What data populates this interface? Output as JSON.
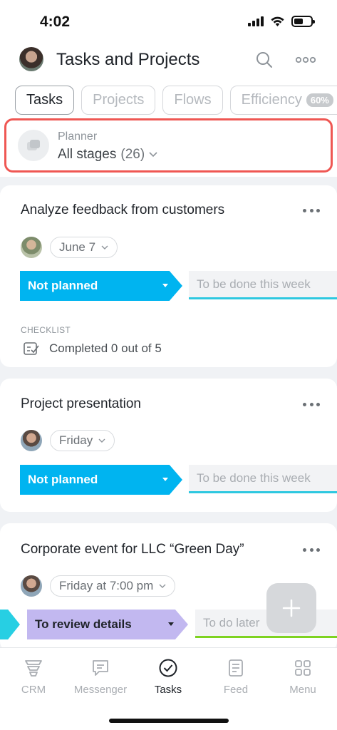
{
  "status_bar": {
    "time": "4:02",
    "battery_level": 0.55
  },
  "header": {
    "title": "Tasks and Projects",
    "icons": [
      "search-icon",
      "more-icon"
    ]
  },
  "tabs": [
    {
      "label": "Tasks",
      "active": true
    },
    {
      "label": "Projects",
      "active": false
    },
    {
      "label": "Flows",
      "active": false
    },
    {
      "label": "Efficiency",
      "active": false,
      "badge": "60%"
    }
  ],
  "planner": {
    "label": "Planner",
    "value": "All stages",
    "count": "(26)"
  },
  "tasks": [
    {
      "title": "Analyze feedback from customers",
      "date": "June 7",
      "stage": "Not planned",
      "next_stage": "To be done this week",
      "checklist": {
        "label": "CHECKLIST",
        "text": "Completed 0 out of 5"
      }
    },
    {
      "title": "Project presentation",
      "date": "Friday",
      "stage": "Not planned",
      "next_stage": "To be done this week"
    },
    {
      "title": "Corporate event for LLC “Green Day”",
      "date": "Friday at 7:00 pm",
      "stage": "To review details",
      "next_stage": "To do later"
    }
  ],
  "colors": {
    "stage_not_planned": "#00b4f0",
    "stage_review": "#c2b8f0",
    "stage_prev": "#27cfe3",
    "next_week_underline": "#2ec8e0",
    "do_later_underline": "#7ed321",
    "highlight": "#ef5753"
  },
  "bottom_nav": [
    {
      "label": "CRM",
      "icon": "crm-icon",
      "active": false
    },
    {
      "label": "Messenger",
      "icon": "messenger-icon",
      "active": false
    },
    {
      "label": "Tasks",
      "icon": "tasks-check-icon",
      "active": true
    },
    {
      "label": "Feed",
      "icon": "feed-icon",
      "active": false
    },
    {
      "label": "Menu",
      "icon": "menu-grid-icon",
      "active": false
    }
  ]
}
